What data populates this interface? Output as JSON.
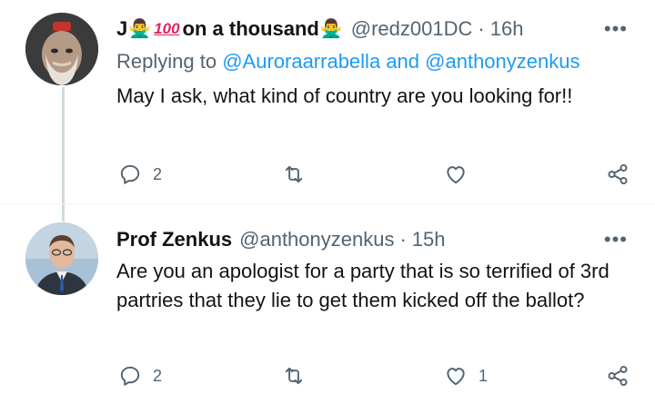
{
  "tweets": [
    {
      "display_name_start": "J",
      "emoji_1": "🙅‍♂️",
      "emoji_100": "100",
      "display_name_mid": "on a thousand",
      "emoji_2": "🙅‍♂️",
      "handle": "@redz001DC",
      "separator": "·",
      "time": "16h",
      "more": "•••",
      "replying_prefix": "Replying to",
      "reply_mention_1": "@Auroraarrabella",
      "reply_and": "and",
      "reply_mention_2": "@anthonyzenkus",
      "text": "May I ask, what kind of country are you looking for!!",
      "replies": "2",
      "retweets": "",
      "likes": ""
    },
    {
      "display_name": "Prof Zenkus",
      "handle": "@anthonyzenkus",
      "separator": "·",
      "time": "15h",
      "more": "•••",
      "text": "Are you an apologist for a party that is so terrified of 3rd partries that they lie to get them kicked off the ballot?",
      "replies": "2",
      "retweets": "",
      "likes": "1"
    }
  ],
  "icons": {
    "reply": "reply-icon",
    "retweet": "retweet-icon",
    "like": "like-icon",
    "share": "share-icon"
  },
  "colors": {
    "link": "#1d9bf0",
    "muted": "#536471",
    "text": "#0f1419",
    "thread_line": "#cfd9de"
  }
}
